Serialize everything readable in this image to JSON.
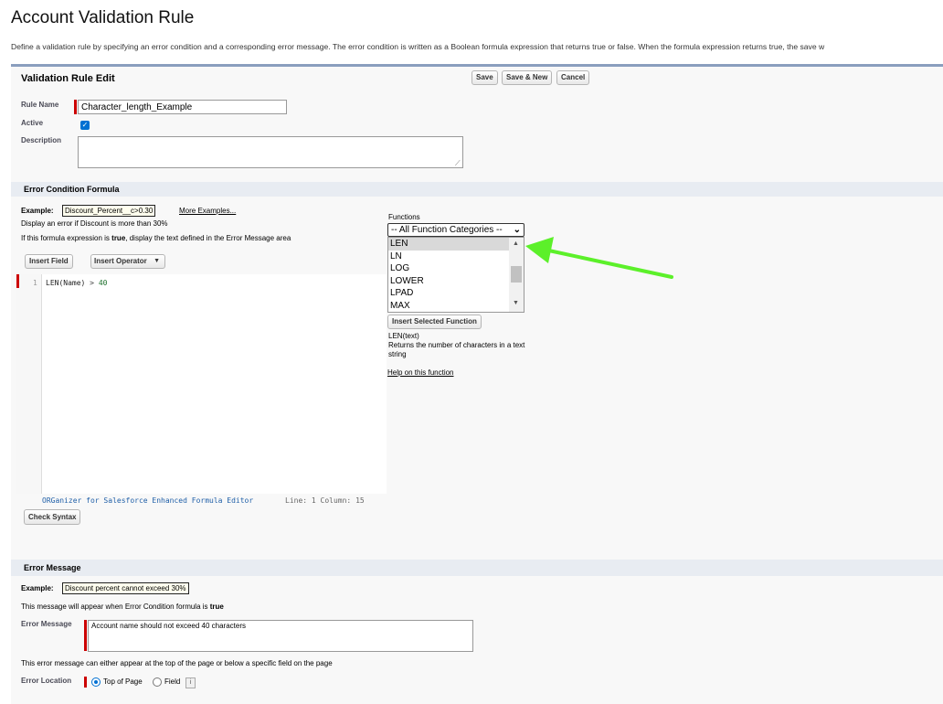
{
  "page": {
    "title": "Account Validation Rule",
    "description": "Define a validation rule by specifying an error condition and a corresponding error message. The error condition is written as a Boolean formula expression that returns true or false. When the formula expression returns true, the save w"
  },
  "edit": {
    "title": "Validation Rule Edit",
    "save_label": "Save",
    "save_new_label": "Save & New",
    "cancel_label": "Cancel"
  },
  "rule": {
    "name_label": "Rule Name",
    "name_value": "Character_length_Example",
    "active_label": "Active",
    "active_checked": true,
    "description_label": "Description",
    "description_value": ""
  },
  "formula": {
    "section_title": "Error Condition Formula",
    "example_label": "Example:",
    "example_value": "Discount_Percent__c>0.30",
    "more_examples": "More Examples...",
    "hint1": "Display an error if Discount is more than 30%",
    "hint2_pre": "If this formula expression is ",
    "hint2_bold": "true",
    "hint2_post": ", display the text defined in the Error Message area",
    "insert_field": "Insert Field",
    "insert_operator": "Insert Operator",
    "line_number": "1",
    "code_fn": "LEN(Name)",
    "code_op": " > ",
    "code_num": "40",
    "editor_brand": "ORGanizer for Salesforce Enhanced Formula Editor",
    "editor_status": "Line: 1 Column: 15",
    "check_syntax": "Check Syntax"
  },
  "functions": {
    "label": "Functions",
    "category_selected": "-- All Function Categories --",
    "items": [
      "LEN",
      "LN",
      "LOG",
      "LOWER",
      "LPAD",
      "MAX"
    ],
    "selected": "LEN",
    "insert_selected": "Insert Selected Function",
    "signature": "LEN(text)",
    "desc": "Returns the number of characters in a text string",
    "help_link": "Help on this function"
  },
  "error_message": {
    "section_title": "Error Message",
    "example_label": "Example:",
    "example_value": "Discount percent cannot exceed 30%",
    "hint_pre": "This message will appear when Error Condition formula is ",
    "hint_bold": "true",
    "message_label": "Error Message",
    "message_value": "Account name should not exceed 40 characters",
    "location_hint": "This error message can either appear at the top of the page or below a specific field on the page",
    "location_label": "Error Location",
    "location_top": "Top of Page",
    "location_field": "Field",
    "location_selected": "Top of Page"
  },
  "colors": {
    "accent_arrow": "#5cf02a",
    "required_bar": "#cc0000",
    "checkbox": "#0070d2",
    "code_number": "#1b6e2a",
    "editor_brand": "#1f5fa8"
  }
}
